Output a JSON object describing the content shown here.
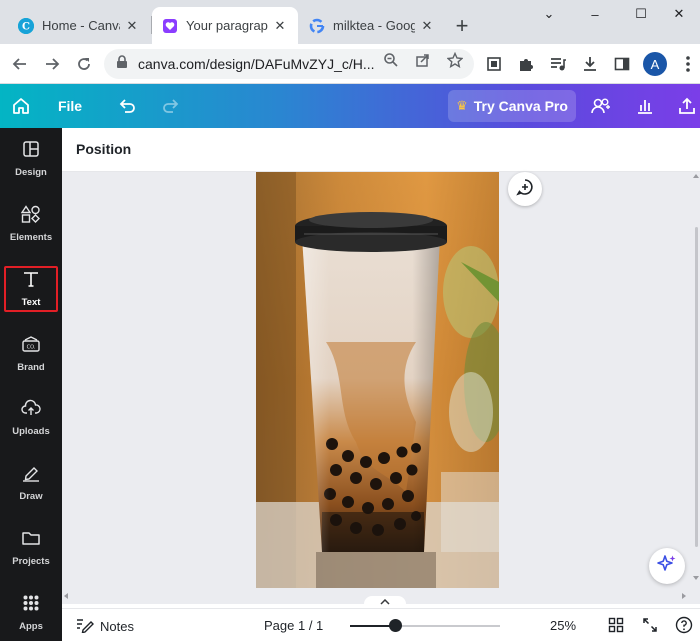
{
  "browser": {
    "tabs": [
      {
        "title": "Home - Canva",
        "icon": "canva-icon",
        "active": false
      },
      {
        "title": "Your paragraph",
        "icon": "canva-heart-icon",
        "active": true
      },
      {
        "title": "milktea - Goog",
        "icon": "google-icon",
        "active": false
      }
    ],
    "new_tab_label": "+",
    "window_controls": {
      "collapse": "⌄",
      "minimize": "–",
      "maximize": "☐",
      "close": "✕"
    },
    "url": "canva.com/design/DAFuMvZYJ_c/H...",
    "avatar_letter": "A"
  },
  "canva": {
    "header": {
      "file_label": "File",
      "try_pro_label": "Try Canva Pro"
    },
    "sidebar": [
      {
        "label": "Design",
        "icon": "layout-icon",
        "selected": false
      },
      {
        "label": "Elements",
        "icon": "shapes-icon",
        "selected": false
      },
      {
        "label": "Text",
        "icon": "text-t-icon",
        "selected": true
      },
      {
        "label": "Brand",
        "icon": "brand-kit-icon",
        "selected": false
      },
      {
        "label": "Uploads",
        "icon": "cloud-upload-icon",
        "selected": false
      },
      {
        "label": "Draw",
        "icon": "pen-icon",
        "selected": false
      },
      {
        "label": "Projects",
        "icon": "folder-icon",
        "selected": false
      },
      {
        "label": "Apps",
        "icon": "apps-grid-icon",
        "selected": false
      }
    ],
    "context_bar": {
      "position_label": "Position"
    },
    "canvas": {
      "image_subject": "milk tea with boba in a plastic cup"
    },
    "footer": {
      "notes_label": "Notes",
      "page_indicator": "Page 1 / 1",
      "zoom_level": 25,
      "zoom_label": "25%",
      "zoom_fraction": 0.3
    }
  },
  "colors": {
    "header_gradient_start": "#03b5c4",
    "header_gradient_end": "#7b3ee8",
    "sidebar_bg": "#18191b",
    "selected_outline": "#e21f26",
    "crown": "#ffc83d",
    "workspace_bg": "#ebecf0"
  }
}
